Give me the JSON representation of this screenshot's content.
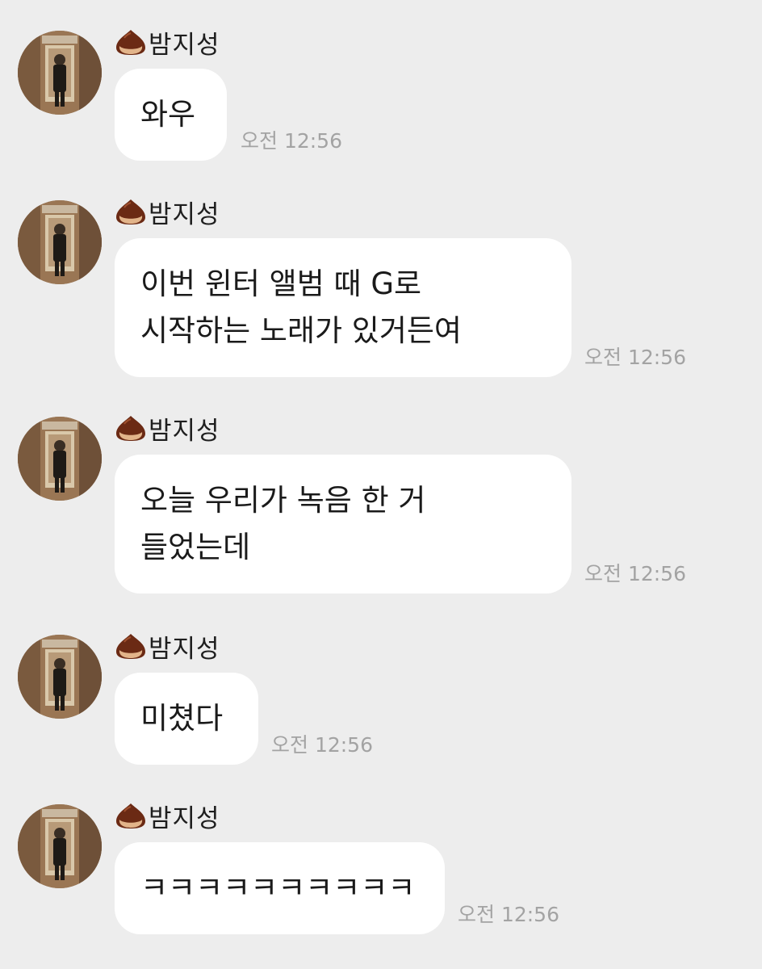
{
  "messages": [
    {
      "sender": "밤지성",
      "lines": [
        "와우"
      ],
      "time": "오전 12:56"
    },
    {
      "sender": "밤지성",
      "lines": [
        "이번 윈터 앨범 때 G로",
        "시작하는 노래가 있거든여"
      ],
      "time": "오전 12:56"
    },
    {
      "sender": "밤지성",
      "lines": [
        "오늘 우리가 녹음 한 거",
        "들었는데"
      ],
      "time": "오전 12:56"
    },
    {
      "sender": "밤지성",
      "lines": [
        "미쳤다"
      ],
      "time": "오전 12:56"
    },
    {
      "sender": "밤지성",
      "lines": [
        "ㅋㅋㅋㅋㅋㅋㅋㅋㅋㅋ"
      ],
      "time": "오전 12:56"
    }
  ],
  "sender_icon": "chestnut-icon",
  "colors": {
    "background": "#ededed",
    "bubble": "#ffffff",
    "text": "#1a1a1a",
    "timestamp": "#a3a3a3"
  }
}
